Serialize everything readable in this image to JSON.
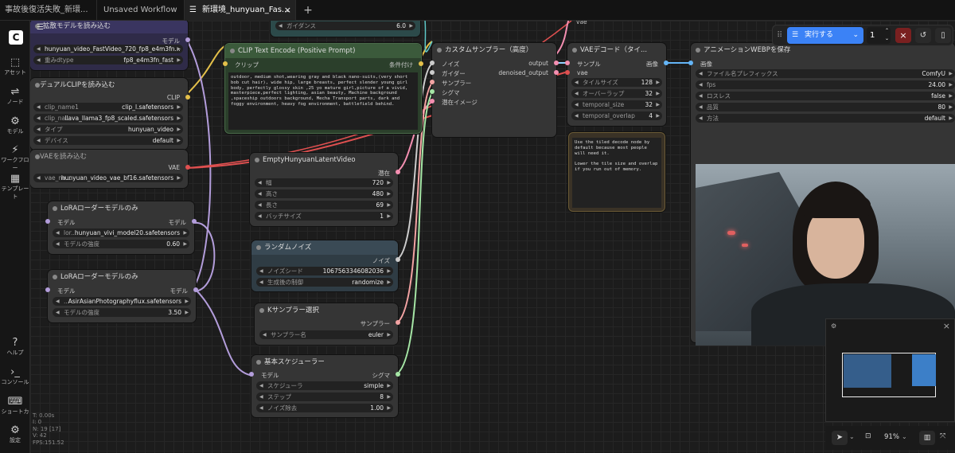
{
  "tabs": [
    "事故後復活失敗_新環...",
    "Unsaved Workflow",
    "新環境_hunyuan_Fas..."
  ],
  "sidebar": {
    "items": [
      {
        "icon": "⬚",
        "label": "アセット"
      },
      {
        "icon": "⇌",
        "label": "ノード"
      },
      {
        "icon": "⚙",
        "label": "モデル"
      },
      {
        "icon": "⚡",
        "label": "ワークフロー"
      },
      {
        "icon": "▦",
        "label": "テンプレート"
      }
    ],
    "bottom": [
      {
        "icon": "?",
        "label": "ヘルプ"
      },
      {
        "icon": "›_",
        "label": "コンソール"
      },
      {
        "icon": "⌨",
        "label": "ショートカ"
      },
      {
        "icon": "⚙",
        "label": "設定"
      }
    ]
  },
  "stats": [
    "T: 0.00s",
    "I: 0",
    "N: 19 [17]",
    "V: 42",
    "FPS:151.52"
  ],
  "run": {
    "label": "実行する",
    "count": "1"
  },
  "zoom": "91%",
  "nodes": {
    "ext": {
      "title": "拡散モデルを読み込む",
      "out": "モデル",
      "w": [
        [
          "",
          "hunyuan_video_FastVideo_720_fp8_e4m3fn..."
        ],
        [
          "重みdtype",
          "fp8_e4m3fn_fast"
        ]
      ]
    },
    "dual": {
      "title": "デュアルCLIPを読み込む",
      "out": "CLIP",
      "w": [
        [
          "clip_name1",
          "clip_l.safetensors"
        ],
        [
          "clip_na...",
          "llava_llama3_fp8_scaled.safetensors"
        ],
        [
          "タイプ",
          "hunyuan_video"
        ],
        [
          "デバイス",
          "default"
        ]
      ]
    },
    "vae": {
      "title": "VAEを読み込む",
      "out": "VAE",
      "w": [
        [
          "vae_na...",
          "hunyuan_video_vae_bf16.safetensors"
        ]
      ]
    },
    "lora1": {
      "title": "LoRAローダーモデルのみ",
      "in": "モデル",
      "out": "モデル",
      "w": [
        [
          "lor...",
          "hunyuan_vivi_model20.safetensors"
        ],
        [
          "モデルの強度",
          "0.60"
        ]
      ]
    },
    "lora2": {
      "title": "LoRAローダーモデルのみ",
      "in": "モデル",
      "out": "モデル",
      "w": [
        [
          "...",
          "AsirAsianPhotographyflux.safetensors"
        ],
        [
          "モデルの強度",
          "3.50"
        ]
      ]
    },
    "guid": {
      "w": [
        [
          "ガイダンス",
          "6.0"
        ]
      ]
    },
    "clip": {
      "title": "CLIP Text Encode (Positive Prompt)",
      "in": "クリップ",
      "out": "条件付け",
      "text": "outdoor, medium shot,wearing gray and black nano-suits,(very short bob cut hair), wide hip, large breasts, perfect slender young girl body, perfectly glossy skin ,25 yo mature girl,picture of a vivid, masterpiece,perfect lighting, asian beauty, Machine background ,spaceship outdoors background, Mecha Transport parts, dark and foggy environment, heavy fog environment, battlefield behind."
    },
    "empty": {
      "title": "EmptyHunyuanLatentVideo",
      "out": "潜在",
      "w": [
        [
          "幅",
          "720"
        ],
        [
          "高さ",
          "480"
        ],
        [
          "長さ",
          "69"
        ],
        [
          "バッチサイズ",
          "1"
        ]
      ]
    },
    "noise": {
      "title": "ランダムノイズ",
      "out": "ノイズ",
      "w": [
        [
          "ノイズシード",
          "1067563346082036"
        ],
        [
          "生成後の制御",
          "randomize"
        ]
      ]
    },
    "ksel": {
      "title": "Kサンプラー選択",
      "out": "サンプラー",
      "w": [
        [
          "サンプラー名",
          "euler"
        ]
      ]
    },
    "sched": {
      "title": "基本スケジューラー",
      "in": "モデル",
      "out": "シグマ",
      "w": [
        [
          "スケジューラ",
          "simple"
        ],
        [
          "ステップ",
          "8"
        ],
        [
          "ノイズ除去",
          "1.00"
        ]
      ]
    },
    "custom": {
      "title": "カスタムサンプラー（高度）",
      "ins": [
        "ノイズ",
        "ガイダー",
        "サンプラー",
        "シグマ",
        "潜在イメージ"
      ],
      "outs": [
        "output",
        "denoised_output"
      ]
    },
    "vaedec": {
      "title": "VAEデコード（タイ...",
      "ins": [
        "サンプル",
        "vae"
      ],
      "out": "画像",
      "w": [
        [
          "タイルサイズ",
          "128"
        ],
        [
          "オーバーラップ",
          "32"
        ],
        [
          "temporal_size",
          "32"
        ],
        [
          "temporal_overlap",
          "4"
        ]
      ]
    },
    "note": {
      "text": "Use the tiled decode node by default because most people will need it.\n\nLower the tile size and overlap if you run out of memory."
    },
    "webp": {
      "title": "アニメーションWEBPを保存",
      "in": "画像",
      "w": [
        [
          "ファイル名プレフィックス",
          "ComfyU"
        ],
        [
          "fps",
          "24.00"
        ],
        [
          "ロスレス",
          "false"
        ],
        [
          "品質",
          "80"
        ],
        [
          "方法",
          "default"
        ]
      ]
    }
  },
  "vae_top": "vae"
}
